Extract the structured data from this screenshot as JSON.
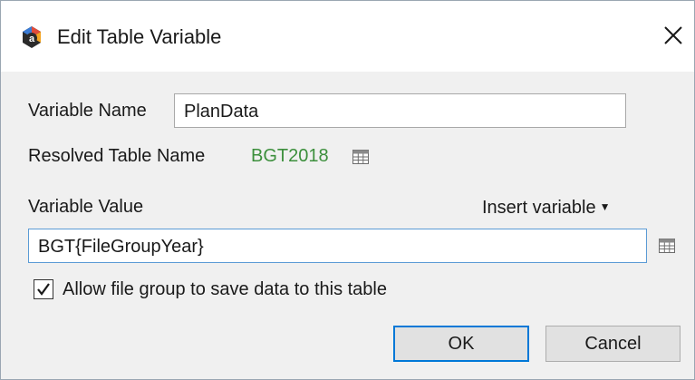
{
  "window": {
    "title": "Edit Table Variable",
    "icon": "app-logo-icon",
    "close_icon": "close-icon"
  },
  "form": {
    "variable_name_label": "Variable Name",
    "variable_name_value": "PlanData",
    "resolved_table_label": "Resolved Table Name",
    "resolved_table_value": "BGT2018",
    "resolved_table_color": "#3c8f3c",
    "variable_value_label": "Variable Value",
    "insert_variable_label": "Insert variable",
    "variable_value": "BGT{FileGroupYear}",
    "allow_save_label": "Allow file group to save data to this table",
    "allow_save_checked": true
  },
  "buttons": {
    "ok_label": "OK",
    "cancel_label": "Cancel"
  },
  "colors": {
    "dialog_background": "#f0f0f0",
    "focus_border": "#5b9bd5",
    "default_button_border": "#0078d7"
  }
}
